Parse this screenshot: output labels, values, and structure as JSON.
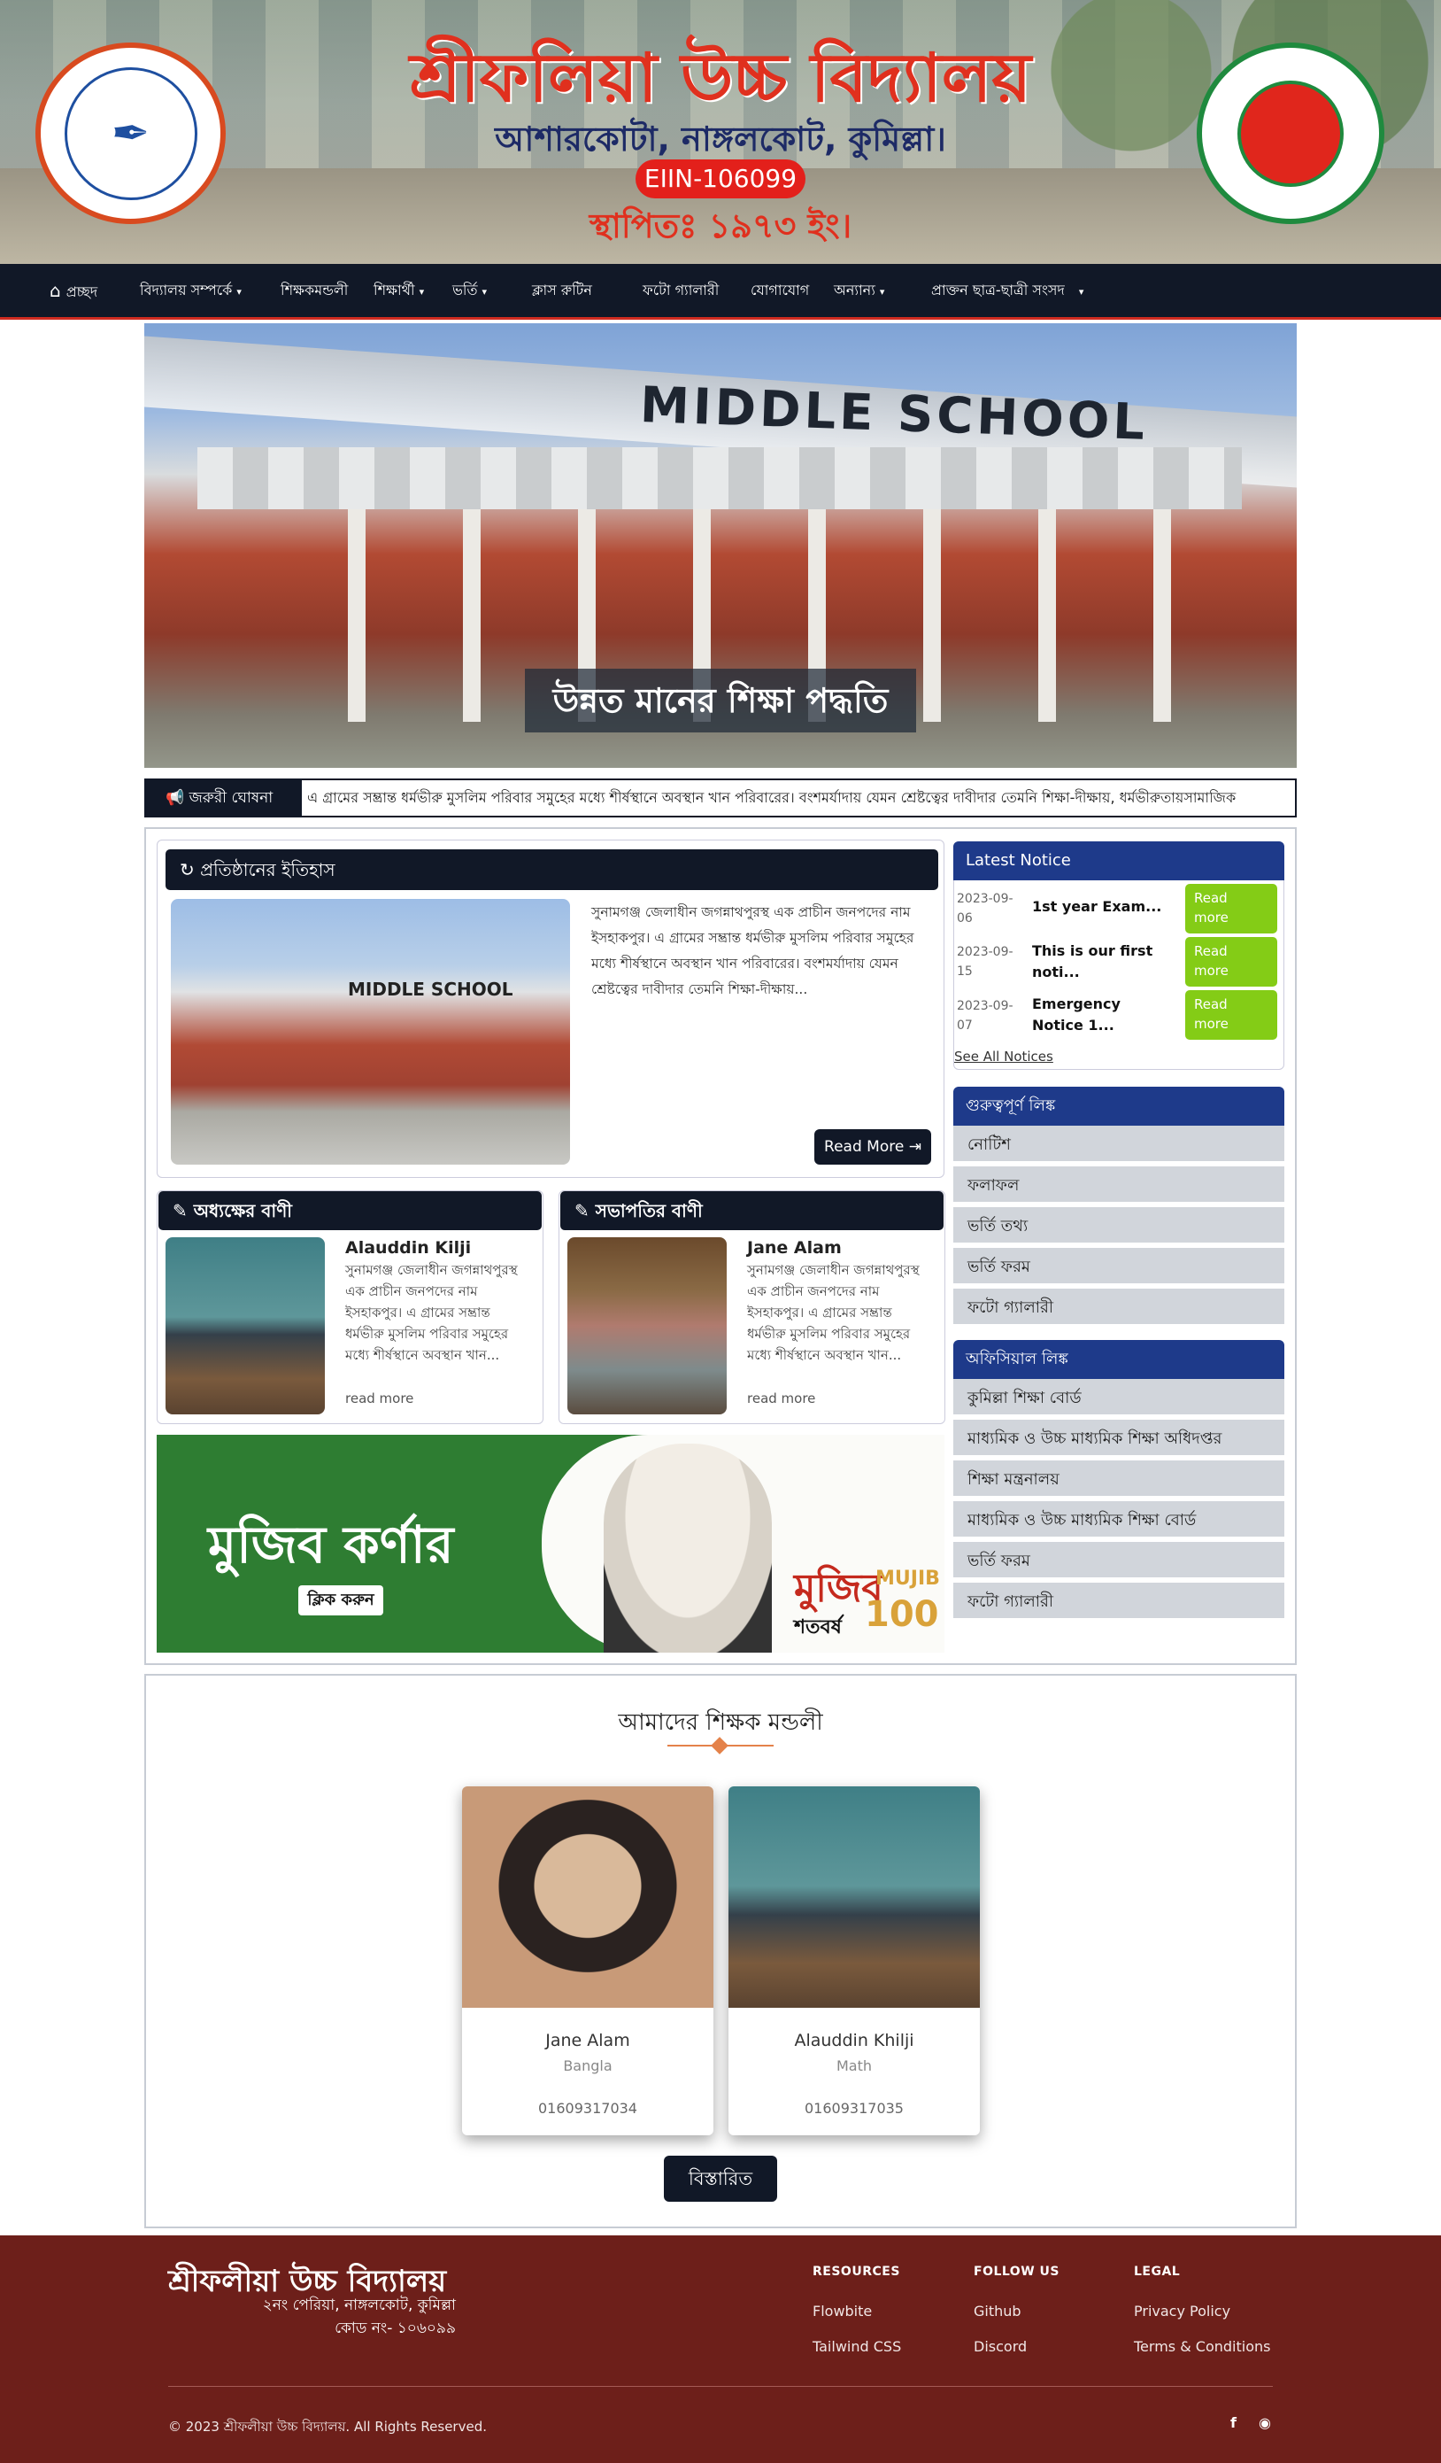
{
  "header": {
    "title": "শ্রীফলিয়া উচ্চ বিদ্যালয়",
    "subtitle": "আশারকোটা, নাঙ্গলকোট, কুমিল্লা।",
    "eiin": "EIIN-106099",
    "established": "স্থাপিতঃ ১৯৭৩ ইং।"
  },
  "nav": {
    "home": "প্রচ্ছদ",
    "about": "বিদ্যালয় সম্পর্কে",
    "teachers": "শিক্ষকমন্ডলী",
    "students": "শিক্ষার্থী",
    "admission": "ভর্তি",
    "routine": "ক্লাস রুটিন",
    "gallery": "ফটো গ্যালারী",
    "contact": "যোগাযোগ",
    "others": "অন্যান্য",
    "alumni": "প্রাক্তন ছাত্র-ছাত্রী সংসদ"
  },
  "hero": {
    "sign": "MIDDLE SCHOOL",
    "caption": "উন্নত মানের শিক্ষা পদ্ধতি"
  },
  "marquee": {
    "label": "জরুরী ঘোষনা",
    "text": "এ গ্রামের সম্ভ্রান্ত ধর্মভীরু মুসলিম পরিবার সমুহের মধ্যে শীর্ষস্থানে অবস্থান খান পরিবারের। বংশমর্যাদায় যেমন শ্রেষ্টত্বের দাবীদার তেমনি শিক্ষা-দীক্ষায়, ধর্মভীরুতায়সামাজিক"
  },
  "history": {
    "heading": "প্রতিষ্ঠানের ইতিহাস",
    "image_sign": "MIDDLE SCHOOL",
    "text": "সুনামগঞ্জ জেলাধীন জগন্নাথপুরস্থ এক প্রাচীন জনপদের নাম ইসহাকপুর। এ গ্রামের সম্ভ্রান্ত ধর্মভীরু মুসলিম পরিবার সমুহের মধ্যে শীর্ষস্থানে অবস্থান খান পরিবারের। বংশমর্যাদায় যেমন শ্রেষ্টত্বের দাবীদার তেমনি শিক্ষা-দীক্ষায়...",
    "button": "Read More"
  },
  "messages": [
    {
      "heading": "অধ্যক্ষের বাণী",
      "name": "Alauddin Kilji",
      "text": "সুনামগঞ্জ জেলাধীন জগন্নাথপুরস্থ এক প্রাচীন জনপদের নাম ইসহাকপুর। এ গ্রামের সম্ভ্রান্ত ধর্মভীরু মুসলিম পরিবার সমুহের মধ্যে শীর্ষস্থানে অবস্থান খান...",
      "more": "read more"
    },
    {
      "heading": "সভাপতির বাণী",
      "name": "Jane Alam",
      "text": "সুনামগঞ্জ জেলাধীন জগন্নাথপুরস্থ এক প্রাচীন জনপদের নাম ইসহাকপুর। এ গ্রামের সম্ভ্রান্ত ধর্মভীরু মুসলিম পরিবার সমুহের মধ্যে শীর্ষস্থানে অবস্থান খান...",
      "more": "read more"
    }
  ],
  "mujib": {
    "title": "মুজিব কর্ণার",
    "click": "ক্লিক করুন",
    "tag": "মুজিব",
    "tag_en": "MUJIB",
    "hundred": "100",
    "sub": "শতবর্ষ"
  },
  "notices": {
    "heading": "Latest Notice",
    "items": [
      {
        "date_line1": "2023-09-",
        "date_line2": "06",
        "title_line1": "1st year Exam...",
        "title_line2": "",
        "button_line1": "Read",
        "button_line2": "more"
      },
      {
        "date_line1": "2023-09-",
        "date_line2": "15",
        "title_line1": "This is our first",
        "title_line2": "noti...",
        "button_line1": "Read",
        "button_line2": "more"
      },
      {
        "date_line1": "2023-09-",
        "date_line2": "07",
        "title_line1": "Emergency",
        "title_line2": "Notice 1...",
        "button_line1": "Read",
        "button_line2": "more"
      }
    ],
    "see_all": "See All Notices"
  },
  "important_links": {
    "heading": "গুরুত্বপূর্ণ লিঙ্ক",
    "items": [
      "নোটিশ",
      "ফলাফল",
      "ভর্তি তথ্য",
      "ভর্তি ফরম",
      "ফটো গ্যালারী"
    ]
  },
  "official_links": {
    "heading": "অফিসিয়াল লিঙ্ক",
    "items": [
      "কুমিল্লা শিক্ষা বোর্ড",
      "মাধ্যমিক ও উচ্চ মাধ্যমিক শিক্ষা অধিদপ্তর",
      "শিক্ষা মন্ত্রনালয়",
      "মাধ্যমিক ও উচ্চ মাধ্যমিক শিক্ষা বোর্ড",
      "ভর্তি ফরম",
      "ফটো গ্যালারী"
    ]
  },
  "teachers": {
    "heading": "আমাদের শিক্ষক মন্ডলী",
    "cards": [
      {
        "name": "Jane Alam",
        "subject": "Bangla",
        "phone": "01609317034"
      },
      {
        "name": "Alauddin Khilji",
        "subject": "Math",
        "phone": "01609317035"
      }
    ],
    "button": "বিস্তারিত"
  },
  "footer": {
    "name": "শ্রীফলীয়া উচ্চ বিদ্যালয়",
    "address": "২নং পেরিয়া, নাঙ্গলকোট, কুমিল্লা",
    "code": "কোড নং- ১০৬০৯৯",
    "columns": [
      {
        "heading": "RESOURCES",
        "links": [
          "Flowbite",
          "Tailwind CSS"
        ]
      },
      {
        "heading": "FOLLOW US",
        "links": [
          "Github",
          "Discord"
        ]
      },
      {
        "heading": "LEGAL",
        "links": [
          "Privacy Policy",
          "Terms & Conditions"
        ]
      }
    ],
    "copyright": "© 2023 শ্রীফলীয়া উচ্চ বিদ্যালয়. All Rights Reserved."
  },
  "colors": {
    "nav_bg": "#111827",
    "accent_blue": "#1e3a8a",
    "accent_green": "#84cc16",
    "footer_bg": "#6d1f1a",
    "title_red": "#e0301e"
  }
}
